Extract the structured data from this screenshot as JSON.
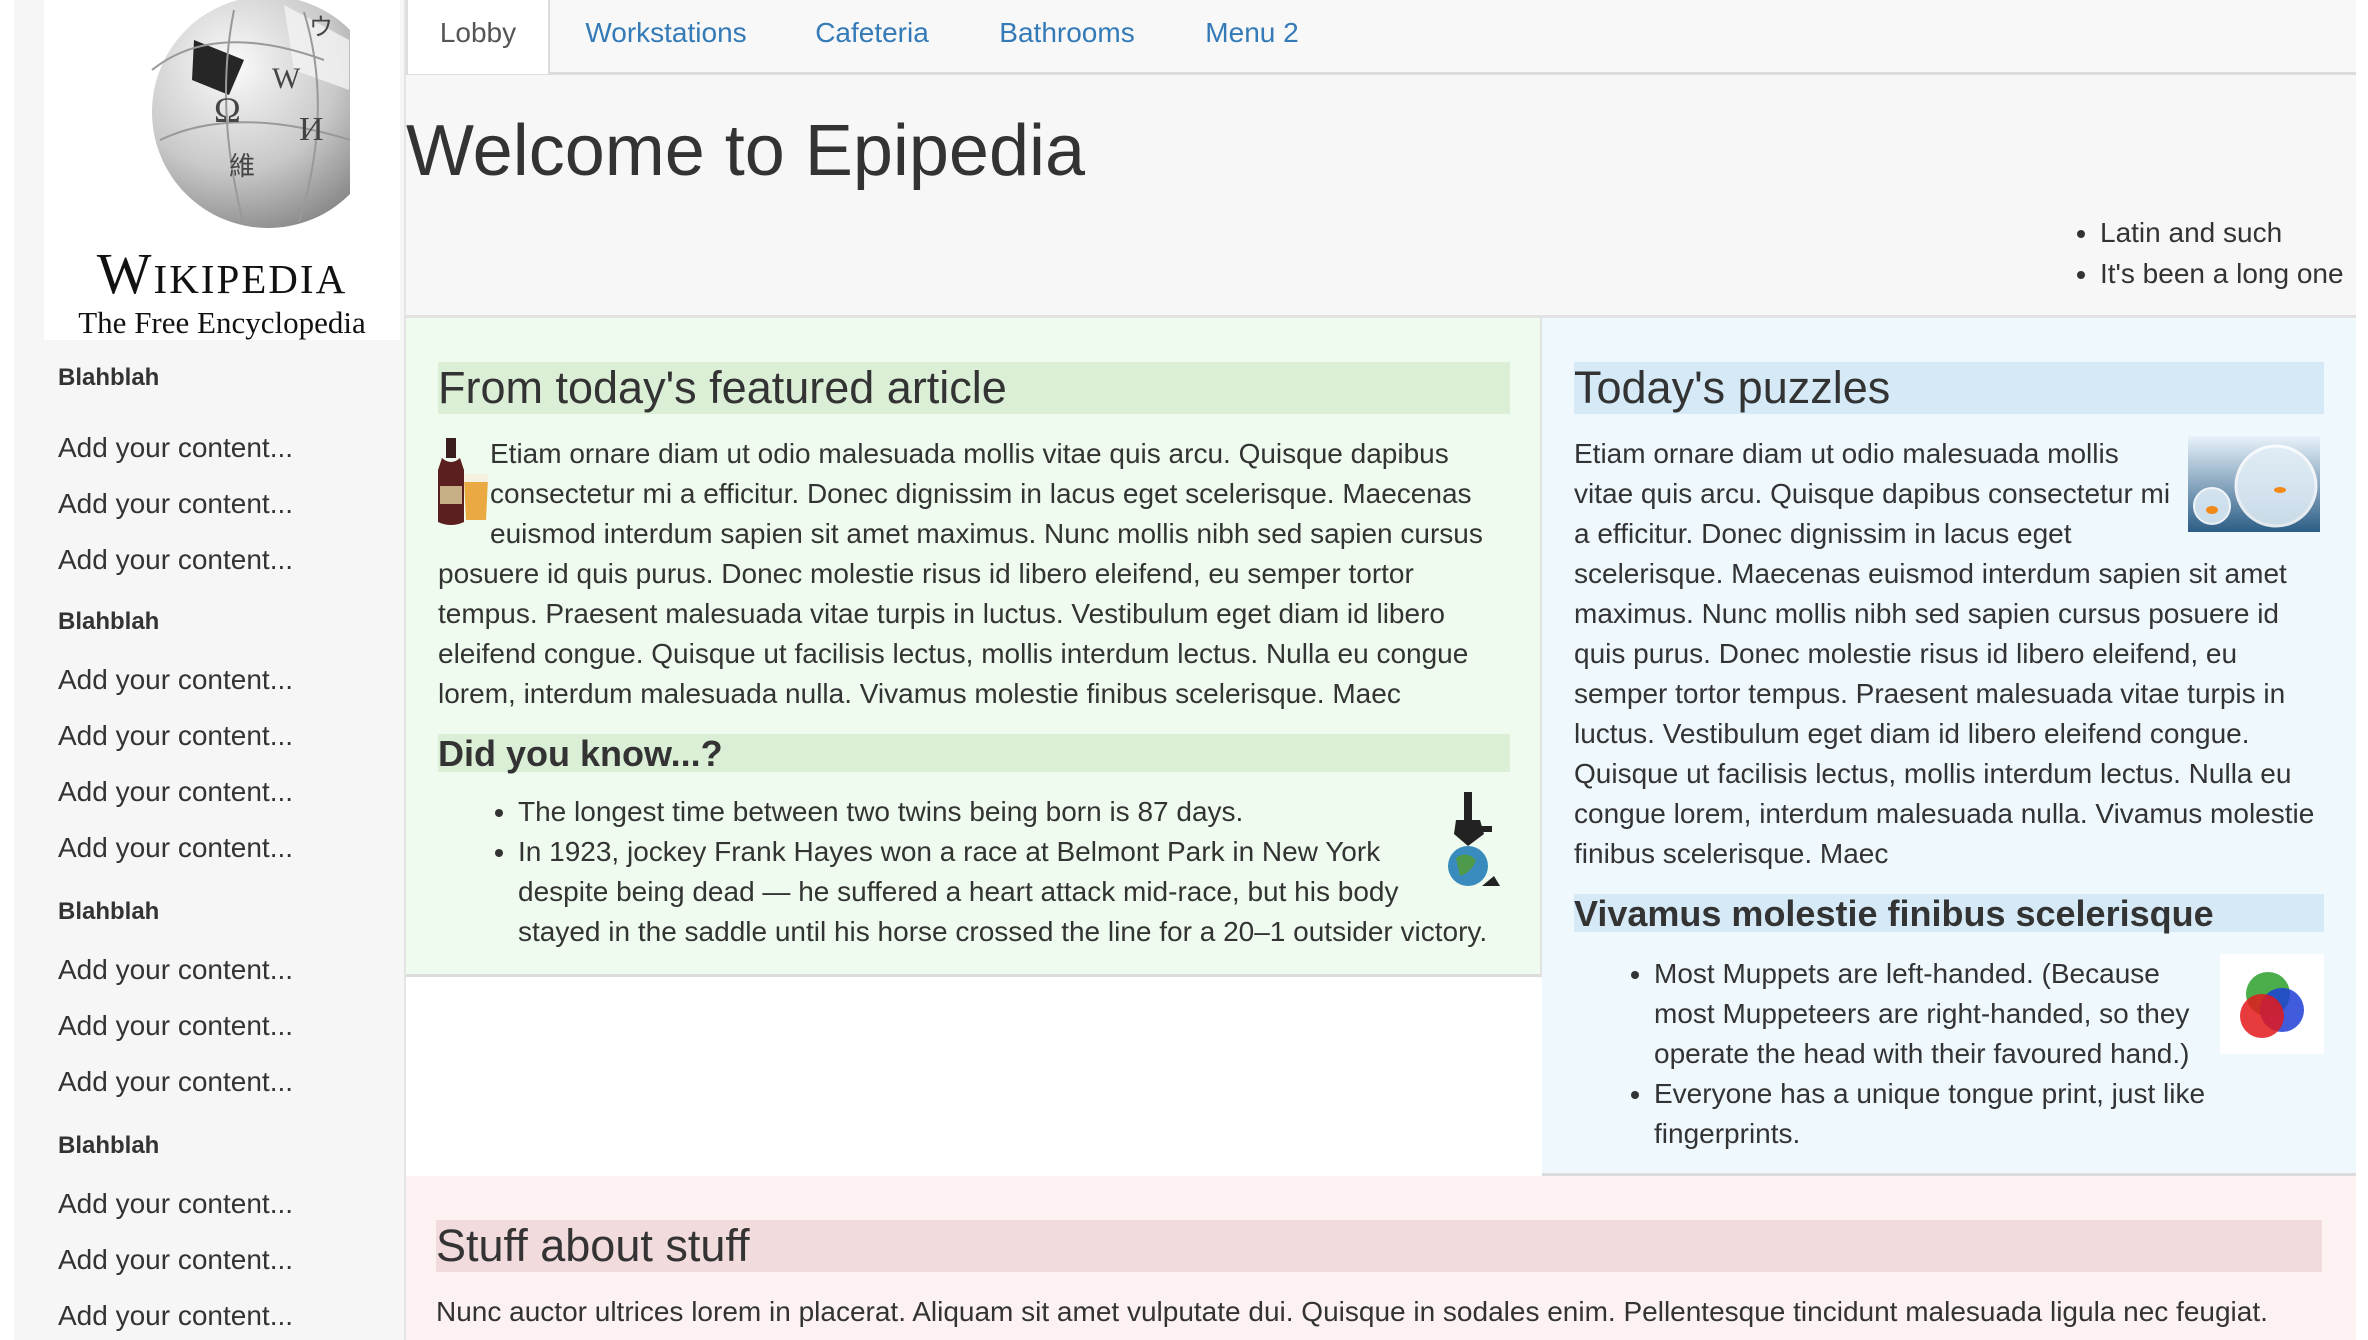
{
  "logo": {
    "wordmark": "Wikipedia",
    "tagline": "The Free Encyclopedia"
  },
  "sidebar": {
    "sections": [
      {
        "heading": "Blahblah",
        "items": [
          "Add your content...",
          "Add your content...",
          "Add your content..."
        ]
      },
      {
        "heading": "Blahblah",
        "items": [
          "Add your content...",
          "Add your content...",
          "Add your content...",
          "Add your content..."
        ]
      },
      {
        "heading": "Blahblah",
        "items": [
          "Add your content...",
          "Add your content...",
          "Add your content..."
        ]
      },
      {
        "heading": "Blahblah",
        "items": [
          "Add your content...",
          "Add your content...",
          "Add your content..."
        ]
      }
    ]
  },
  "nav": {
    "tabs": [
      "Lobby",
      "Workstations",
      "Cafeteria",
      "Bathrooms",
      "Menu 2"
    ],
    "active": "Lobby"
  },
  "header": {
    "title": "Welcome to Epipedia",
    "list": [
      "Latin and such",
      "It's been a long one"
    ]
  },
  "featured": {
    "heading": "From today's featured article",
    "lines": [
      "Etiam ornare diam ut odio malesuada mollis vitae quis arcu. Quisque dapibus",
      "consectetur mi a efficitur. Donec dignissim in lacus eget scelerisque. Maecenas",
      "euismod interdum sapien sit amet maximus. Nunc mollis nibh sed sapien cursus",
      "posuere id quis purus. Donec molestie risus id libero eleifend, eu semper tortor",
      "tempus. Praesent malesuada vitae turpis in luctus. Vestibulum eget diam id libero",
      "eleifend congue. Quisque ut facilisis lectus, mollis interdum lectus. Nulla eu congue",
      "lorem, interdum malesuada nulla. Vivamus molestie finibus scelerisque. Maec"
    ],
    "did_you_know_heading": "Did you know...?",
    "did_you_know_lines": [
      "The longest time between two twins being born is 87 days.",
      "In 1923, jockey Frank Hayes won a race at Belmont Park in New York",
      "despite being dead — he suffered a heart attack mid-race, but his body",
      "stayed in the saddle until his horse crossed the line for a 20–1 outsider victory."
    ]
  },
  "puzzles": {
    "heading": "Today's puzzles",
    "lines": [
      "Etiam ornare diam ut odio malesuada mollis",
      "vitae quis arcu. Quisque dapibus consectetur mi",
      "a efficitur. Donec dignissim in lacus eget",
      "scelerisque. Maecenas euismod interdum sapien sit amet",
      "maximus. Nunc mollis nibh sed sapien cursus posuere id",
      "quis purus. Donec molestie risus id libero eleifend, eu",
      "semper tortor tempus. Praesent malesuada vitae turpis in",
      "luctus. Vestibulum eget diam id libero eleifend congue.",
      "Quisque ut facilisis lectus, mollis interdum lectus. Nulla eu",
      "congue lorem, interdum malesuada nulla. Vivamus molestie",
      "finibus scelerisque. Maec"
    ],
    "subheading": "Vivamus molestie finibus scelerisque",
    "facts_lines": [
      "Most Muppets are left-handed. (Because",
      "most Muppeteers are right-handed, so they",
      "operate the head with their favoured hand.)",
      "Everyone has a unique tongue print, just like",
      "fingerprints."
    ]
  },
  "stuff": {
    "heading": "Stuff about stuff",
    "text": "Nunc auctor ultrices lorem in placerat. Aliquam sit amet vulputate dui. Quisque in sodales enim. Pellentesque tincidunt malesuada ligula nec feugiat."
  },
  "colors": {
    "link": "#337ab7",
    "featured_bg": "#eefbee",
    "featured_heading_bar": "#dbeed6",
    "puzzles_bg": "#eef8fd",
    "puzzles_heading_bar": "#d5e9f6",
    "stuff_bg": "#fcf2f2",
    "stuff_heading_bar": "#f2dbdd"
  }
}
